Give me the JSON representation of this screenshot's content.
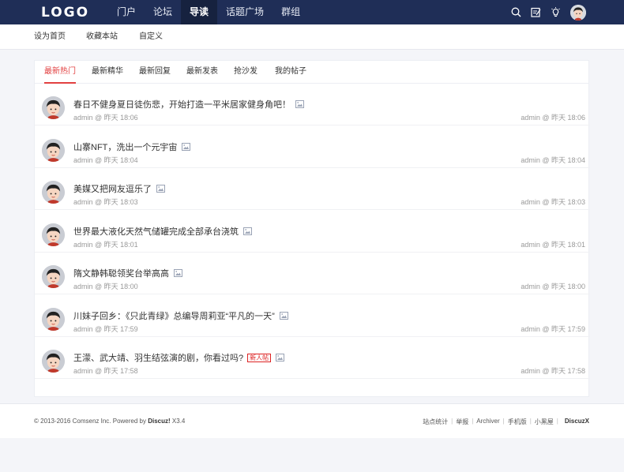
{
  "header": {
    "logo": "LOGO",
    "nav": [
      "门户",
      "论坛",
      "导读",
      "话题广场",
      "群组"
    ],
    "active_nav": 2,
    "icons": [
      "search-icon",
      "edit-icon",
      "lightbulb-icon",
      "avatar"
    ]
  },
  "subnav": [
    "设为首页",
    "收藏本站",
    "自定义"
  ],
  "tabs": [
    "最新热门",
    "最新精华",
    "最新回复",
    "最新发表",
    "抢沙发",
    "我的帖子"
  ],
  "active_tab": 0,
  "threads": [
    {
      "title": "春日不健身夏日徒伤悲，开始打造一平米居家健身角吧！",
      "author": "admin",
      "time": "昨天 18:06",
      "last_author": "admin",
      "last_time": "昨天 18:06",
      "badge": ""
    },
    {
      "title": "山寨NFT，洗出一个元宇宙",
      "author": "admin",
      "time": "昨天 18:04",
      "last_author": "admin",
      "last_time": "昨天 18:04",
      "badge": ""
    },
    {
      "title": "美媒又把网友逗乐了",
      "author": "admin",
      "time": "昨天 18:03",
      "last_author": "admin",
      "last_time": "昨天 18:03",
      "badge": ""
    },
    {
      "title": "世界最大液化天然气储罐完成全部承台浇筑",
      "author": "admin",
      "time": "昨天 18:01",
      "last_author": "admin",
      "last_time": "昨天 18:01",
      "badge": ""
    },
    {
      "title": "隋文静韩聪领奖台举高高",
      "author": "admin",
      "time": "昨天 18:00",
      "last_author": "admin",
      "last_time": "昨天 18:00",
      "badge": ""
    },
    {
      "title": "川妹子回乡：《只此青绿》总编导周莉亚“平凡的一天”",
      "author": "admin",
      "time": "昨天 17:59",
      "last_author": "admin",
      "last_time": "昨天 17:59",
      "badge": ""
    },
    {
      "title": "王濛、武大靖、羽生结弦演的剧，你看过吗?",
      "author": "admin",
      "time": "昨天 17:58",
      "last_author": "admin",
      "last_time": "昨天 17:58",
      "badge": "新人帖"
    }
  ],
  "footer": {
    "copyright_prefix": "© 2013-2016 Comsenz Inc. Powered by",
    "product": "Discuz!",
    "version": "X3.4",
    "links": [
      "站点统计",
      "举报",
      "Archiver",
      "手机版",
      "小黑屋"
    ],
    "brand": "DiscuzX"
  },
  "colors": {
    "header_bg": "#1f2e57",
    "accent": "#e24040"
  }
}
